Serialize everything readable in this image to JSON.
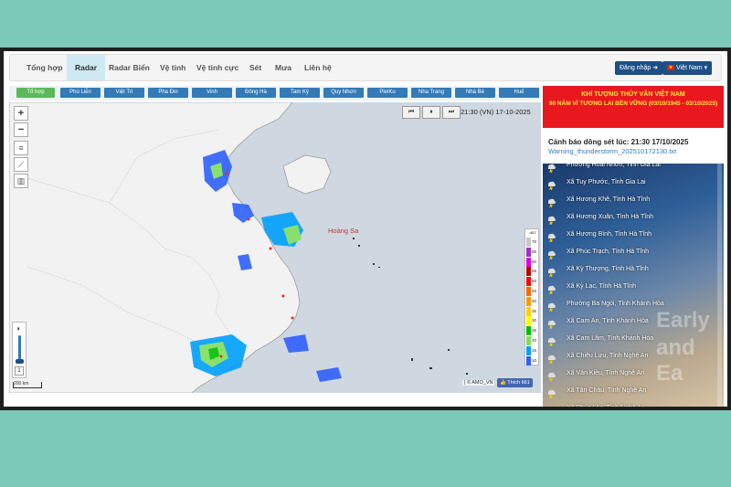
{
  "nav": {
    "items": [
      "Tổng hợp",
      "Radar",
      "Radar Biển",
      "Vệ tinh",
      "Vệ tinh cực",
      "Sét",
      "Mưa",
      "Liên hệ"
    ],
    "active": "Radar",
    "login_label": "Đăng nhập",
    "language_label": "Việt Nam"
  },
  "stations": [
    "Tổ hợp",
    "Phù Liễn",
    "Việt Trì",
    "Pha Đin",
    "Vinh",
    "Đông Hà",
    "Tam Kỳ",
    "Quy Nhơn",
    "PleiKu",
    "Nha Trang",
    "Nhà Bè",
    "Huế"
  ],
  "map": {
    "timestamp": "21:30 (VN) 17-10-2025",
    "place_label": "Hoàng Sa",
    "scale_label": "200 km",
    "attribution": "| © AMO_VN",
    "like_label": "Thích 661",
    "slider_value": "1",
    "legend": {
      "unit": "dBZ",
      "labels": [
        "70",
        "65",
        "60",
        "55",
        "50",
        "45",
        "40",
        "35",
        "30",
        "25",
        "20",
        "15",
        "10"
      ],
      "colors": [
        "#c8c8c8",
        "#9b30d0",
        "#e000e0",
        "#c00000",
        "#ff0000",
        "#ff6600",
        "#ff9900",
        "#ffd000",
        "#ffff00",
        "#00c000",
        "#80e060",
        "#00a0ff",
        "#3060ff"
      ]
    }
  },
  "banner": {
    "line1": "KHÍ TƯỢNG THỦY VĂN VIỆT NAM",
    "line2": "80 NĂM VÌ TƯƠNG LAI BỀN VỮNG (03/10/1945 - 03/10/2025)"
  },
  "warnings": {
    "title": "Cảnh báo dông sét lúc: 21:30 17/10/2025",
    "file": "Warning_thunderstorm_202510172130.txt",
    "items": [
      "Phường Hoài Nhơn, Tỉnh Gia Lai",
      "Xã Tuy Phước, Tỉnh Gia Lai",
      "Xã Hương Khê, Tỉnh Hà Tĩnh",
      "Xã Hương Xuân, Tỉnh Hà Tĩnh",
      "Xã Hương Bình, Tỉnh Hà Tĩnh",
      "Xã Phúc Trạch, Tỉnh Hà Tĩnh",
      "Xã Kỳ Thượng, Tỉnh Hà Tĩnh",
      "Xã Kỳ Lạc, Tỉnh Hà Tĩnh",
      "Phường Ba Ngòi, Tỉnh Khánh Hòa",
      "Xã Cam An, Tỉnh Khánh Hòa",
      "Xã Cam Lâm, Tỉnh Khánh Hòa",
      "Xã Chiêu Lưu, Tỉnh Nghệ An",
      "Xã Vân Kiều, Tỉnh Nghệ An",
      "Xã Tân Châu, Tỉnh Nghệ An",
      "Xã Phúc Lộc, Tỉnh Nghệ An"
    ],
    "background_text": [
      "Early",
      "and Ea"
    ]
  },
  "colors": {
    "nav_button": "#1d4f86",
    "station": "#337ab7",
    "station_active": "#5cb85c",
    "banner": "#e8181e",
    "banner_text": "#ffeb3b"
  }
}
